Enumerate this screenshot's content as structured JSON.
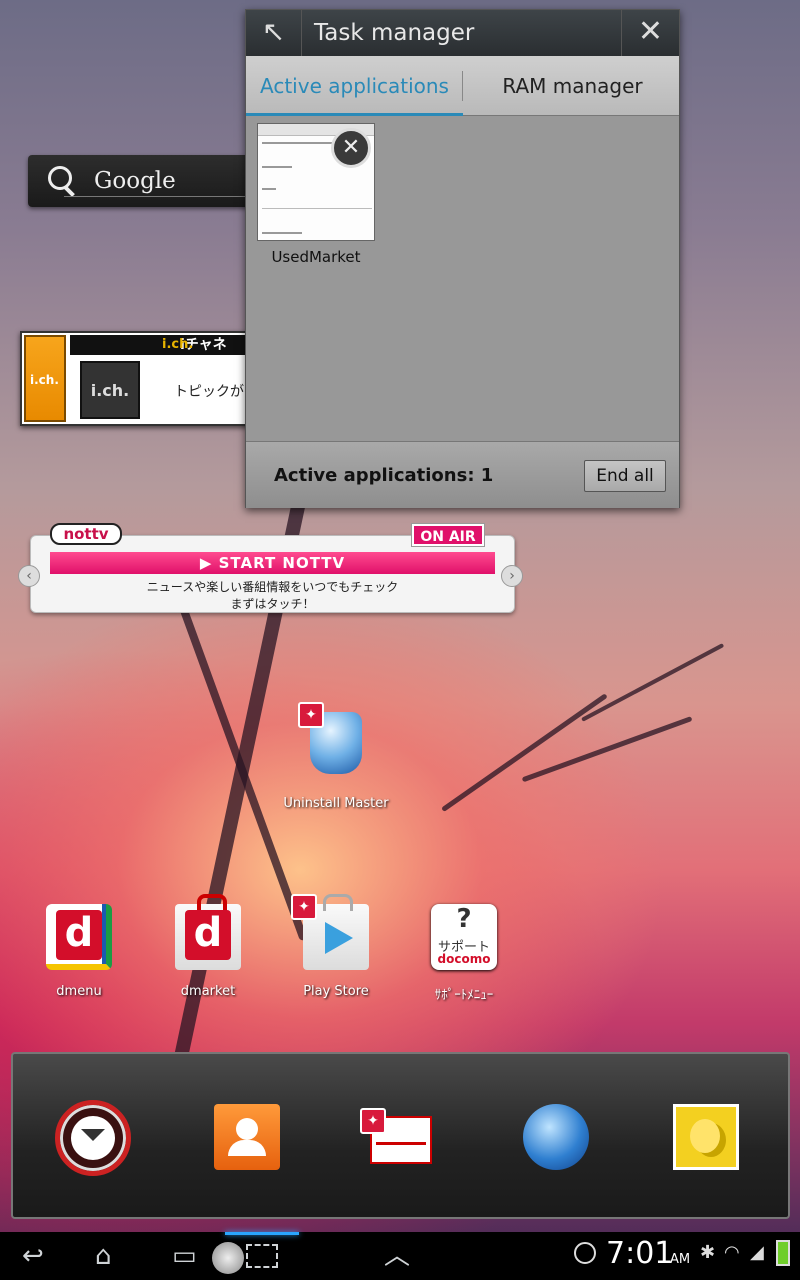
{
  "home": {
    "google_search_label": "Google",
    "ich_widget": {
      "tab_text": "i.ch.",
      "brand": "i.ch.",
      "header_text": "iチャネ",
      "logo_text": "i.ch.",
      "topic_text": "トピックが"
    },
    "nottv_widget": {
      "logo": "nottv",
      "on_air": "ON AIR",
      "start_button": "▶ START  NOTTV",
      "line1": "ニュースや楽しい番組情報をいつでもチェック",
      "line2": "まずはタッチ！",
      "prev_arrow": "‹",
      "next_arrow": "›"
    },
    "apps": [
      {
        "label": "Uninstall Master",
        "icon": "trash-bin-icon",
        "badge": "✦"
      },
      {
        "label": "dmenu",
        "icon": "dmenu-icon",
        "glyph": "d"
      },
      {
        "label": "dmarket",
        "icon": "dmarket-icon",
        "glyph": "d"
      },
      {
        "label": "Play Store",
        "icon": "play-store-icon",
        "badge": "✦"
      },
      {
        "label": "ｻﾎﾟｰﾄﾒﾆｭｰ",
        "icon": "support-icon",
        "q": "?",
        "t1": "サポート",
        "t2": "docomo"
      }
    ],
    "dock": {
      "items": [
        {
          "name": "apps",
          "icon": "app-drawer-icon"
        },
        {
          "name": "contacts",
          "icon": "contacts-icon"
        },
        {
          "name": "mail",
          "icon": "mail-icon",
          "badge": "✦"
        },
        {
          "name": "browser",
          "icon": "globe-icon"
        },
        {
          "name": "gallery",
          "icon": "gallery-icon"
        }
      ]
    }
  },
  "task_manager": {
    "back_glyph": "↖",
    "title": "Task manager",
    "close_glyph": "✕",
    "tabs": [
      {
        "label": "Active applications",
        "active": true
      },
      {
        "label": "RAM manager",
        "active": false
      }
    ],
    "apps": [
      {
        "name": "UsedMarket",
        "close_glyph": "✕"
      }
    ],
    "count_text": "Active applications: 1",
    "end_all_label": "End all"
  },
  "status_bar": {
    "back_glyph": "↩",
    "home_glyph": "⌂",
    "recent_glyph": "▭",
    "up_glyph": "︿",
    "time": "7:01",
    "ampm": "AM",
    "bluetooth_glyph": "✱",
    "wifi_glyph": "◠",
    "signal_glyph": "◢"
  },
  "colors": {
    "accent_tab": "#2a8ab8",
    "docomo_red": "#d30e2a",
    "nottv_pink": "#e0106a",
    "ich_orange": "#f7a51c"
  }
}
